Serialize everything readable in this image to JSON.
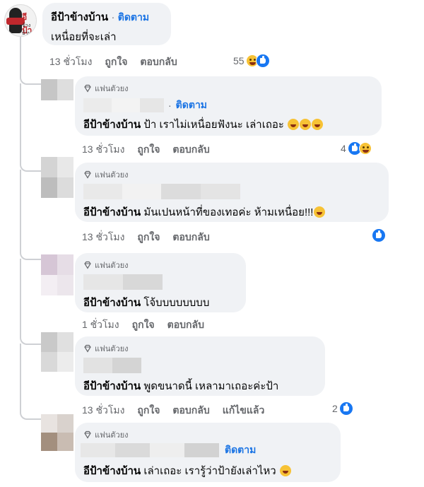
{
  "top_comment": {
    "author": "อีป้าข้างบ้าน",
    "separator": "·",
    "follow": "ติดตาม",
    "text": "เหนื่อยที่จะเล่า",
    "time": "13 ชั่วโมง",
    "like": "ถูกใจ",
    "reply": "ตอบกลับ",
    "reaction_count": "55",
    "logo_text": "อีป้า",
    "logo_sub": "ข้างบ้าน"
  },
  "replies": [
    {
      "badge": "แฟนตัวยง",
      "follow": "ติดตาม",
      "mention": "อีป้าข้างบ้าน",
      "text": "ป้า เราไม่เหนื่อยฟังนะ เล่าเถอะ",
      "time": "13 ชั่วโมง",
      "like": "ถูกใจ",
      "reply": "ตอบกลับ",
      "reaction_count": "4"
    },
    {
      "badge": "แฟนตัวยง",
      "mention": "อีป้าข้างบ้าน",
      "text": "มันเปนหน้าที่ของเทอค่ะ ห้ามเหนื่อย!!!",
      "time": "13 ชั่วโมง",
      "like": "ถูกใจ",
      "reply": "ตอบกลับ"
    },
    {
      "badge": "แฟนตัวยง",
      "mention": "อีป้าข้างบ้าน",
      "text": "โจ้บบบบบบบบ",
      "time": "1 ชั่วโมง",
      "like": "ถูกใจ",
      "reply": "ตอบกลับ"
    },
    {
      "badge": "แฟนตัวยง",
      "mention": "อีป้าข้างบ้าน",
      "text": "พูดขนาดนี้ เหลามาเถอะค่ะป้า",
      "time": "13 ชั่วโมง",
      "like": "ถูกใจ",
      "reply": "ตอบกลับ",
      "edited": "แก้ไขแล้ว",
      "reaction_count": "2"
    },
    {
      "badge": "แฟนตัวยง",
      "follow": "ติดตาม",
      "mention": "อีป้าข้างบ้าน",
      "text": "เล่าเถอะ เรารู้ว่าป้ายังเล่าไหว"
    }
  ],
  "icons": {
    "badge": "diamond-icon",
    "reaction_like": "like-icon",
    "reaction_haha": "haha-icon"
  },
  "colors": {
    "bubble": "#f0f2f5",
    "link": "#1b74e4",
    "meta": "#65676b",
    "like": "#1877f2"
  }
}
